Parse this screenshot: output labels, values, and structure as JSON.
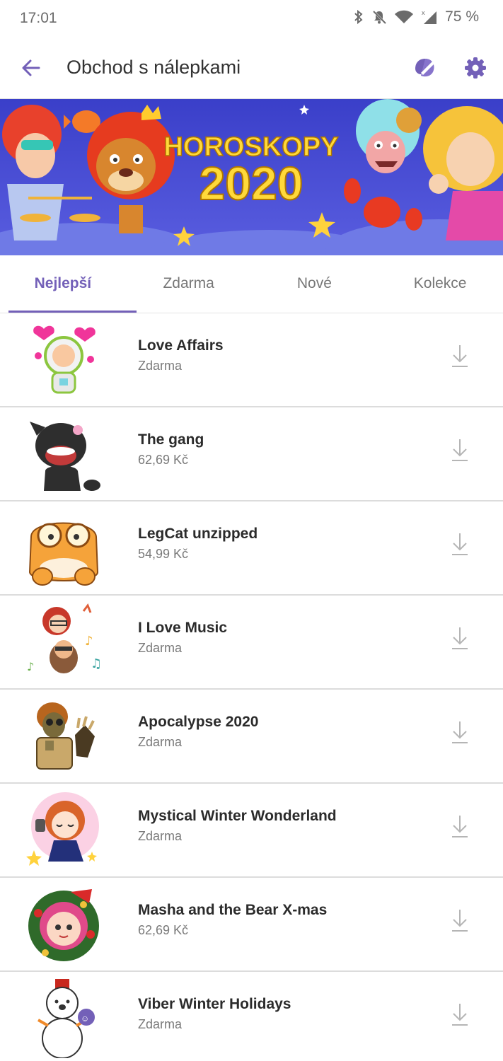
{
  "status_bar": {
    "time": "17:01",
    "battery": "75 %",
    "icons": [
      "bluetooth-icon",
      "mute-icon",
      "wifi-icon",
      "signal-icon"
    ]
  },
  "toolbar": {
    "title": "Obchod s nálepkami",
    "back_icon": "arrow-left-icon",
    "brush_icon": "sticker-create-icon",
    "settings_icon": "gear-icon"
  },
  "banner": {
    "line1": "HOROSKOPY",
    "line2": "2020"
  },
  "tabs": [
    {
      "label": "Nejlepší",
      "active": true
    },
    {
      "label": "Zdarma",
      "active": false
    },
    {
      "label": "Nové",
      "active": false
    },
    {
      "label": "Kolekce",
      "active": false
    }
  ],
  "stickers": [
    {
      "title": "Love Affairs",
      "price": "Zdarma"
    },
    {
      "title": "The gang",
      "price": "62,69 Kč"
    },
    {
      "title": "LegCat unzipped",
      "price": "54,99 Kč"
    },
    {
      "title": "I Love Music",
      "price": "Zdarma"
    },
    {
      "title": "Apocalypse 2020",
      "price": "Zdarma"
    },
    {
      "title": "Mystical Winter Wonderland",
      "price": "Zdarma"
    },
    {
      "title": "Masha and the Bear X-mas",
      "price": "62,69 Kč"
    },
    {
      "title": "Viber Winter Holidays",
      "price": "Zdarma"
    }
  ],
  "colors": {
    "accent": "#7360b8",
    "banner_bg": "#4d50d6"
  }
}
